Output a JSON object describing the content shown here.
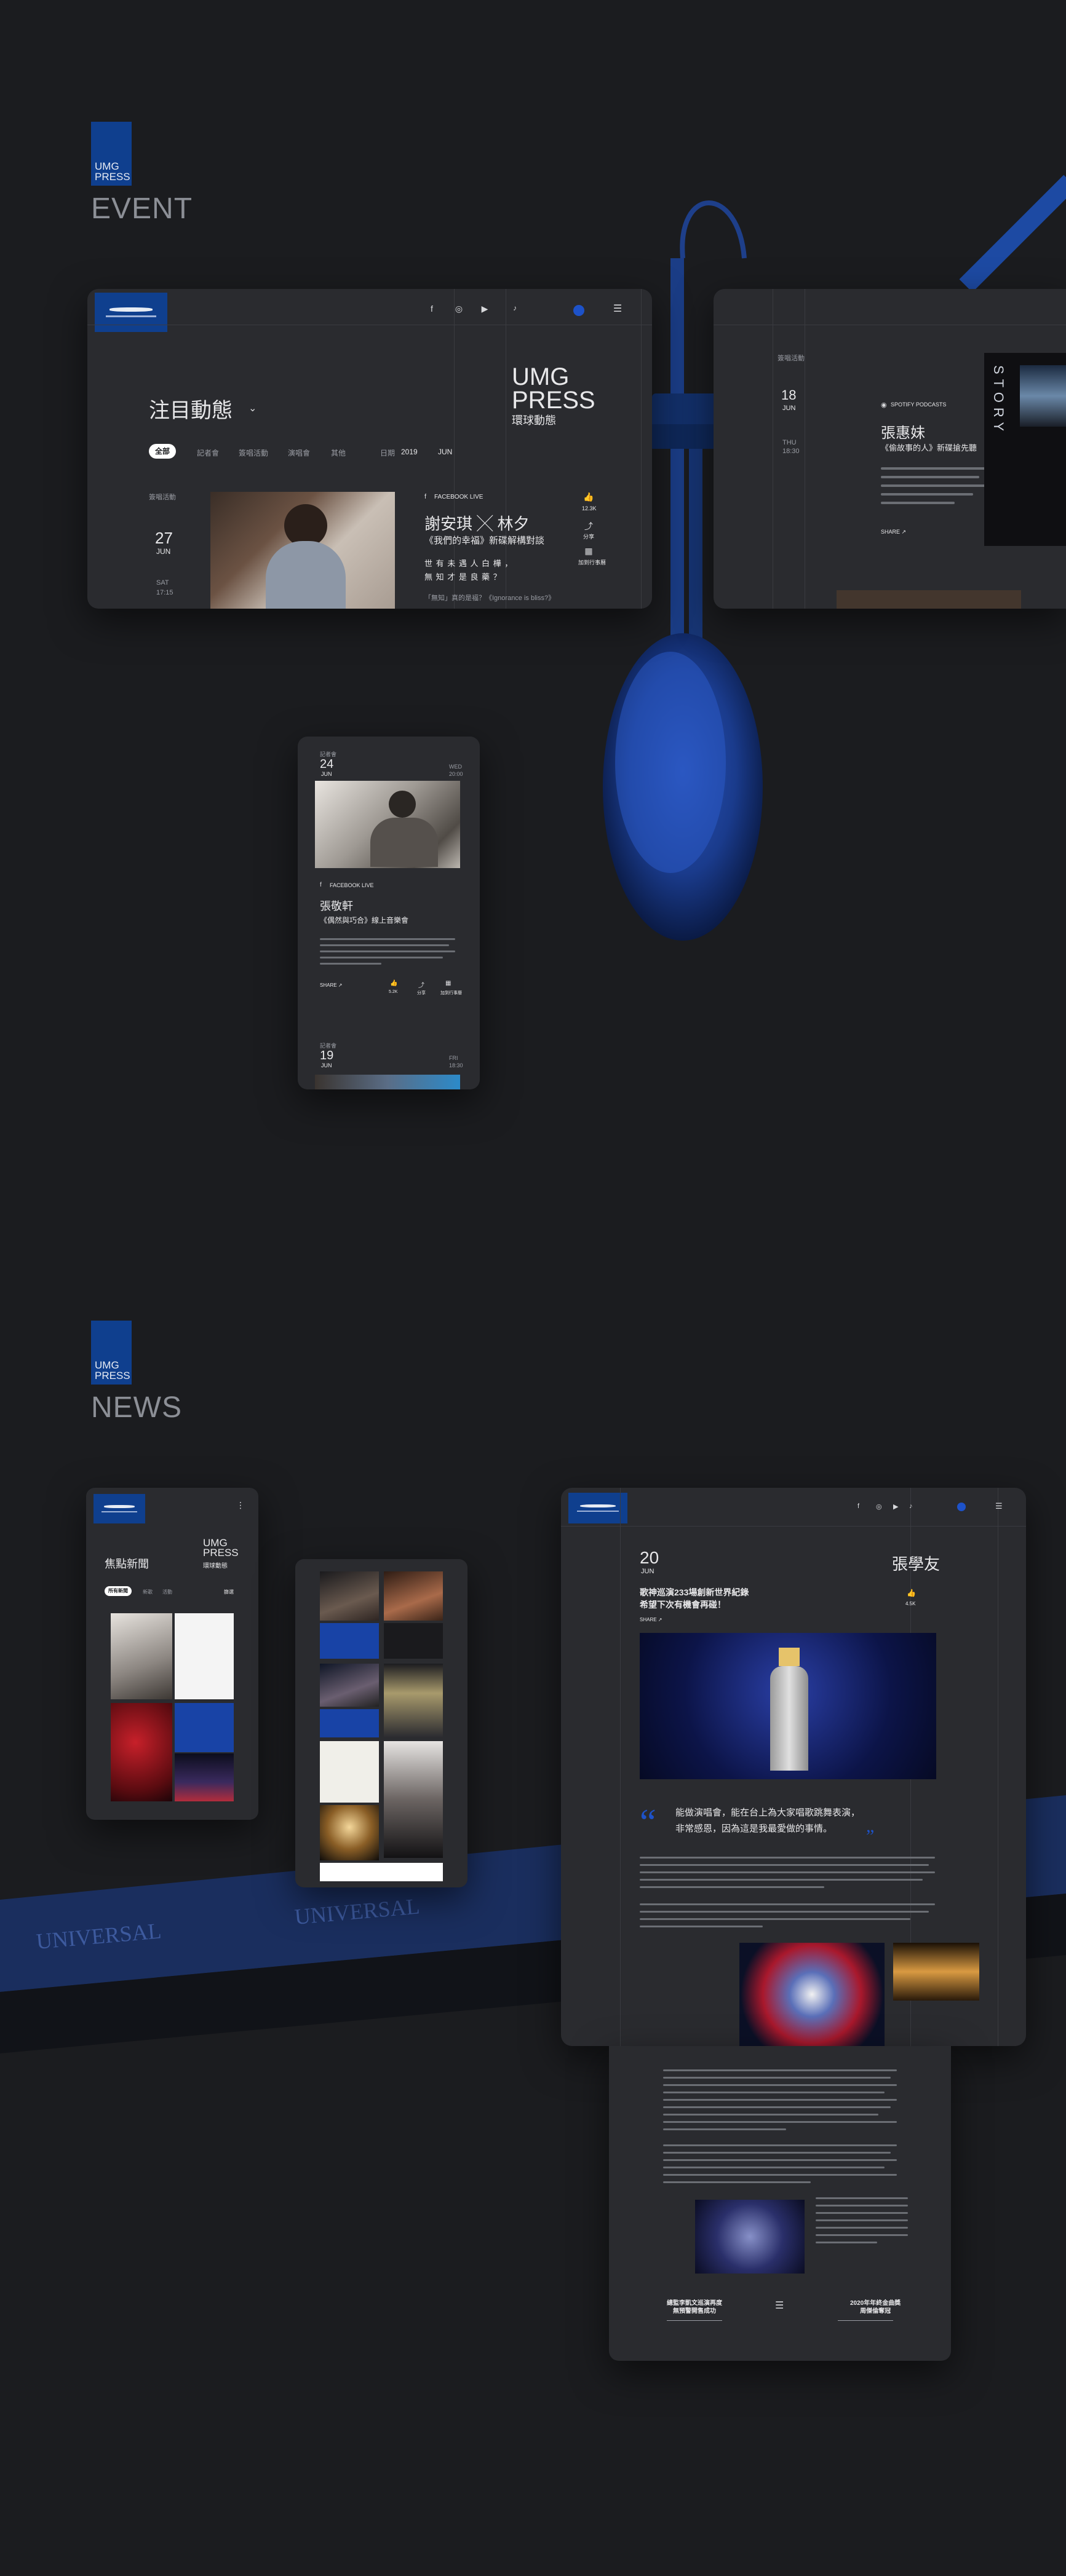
{
  "colors": {
    "background": "#1b1c1f",
    "card": "#2a2b2f",
    "brand_blue": "#0f3f8e",
    "accent_blue": "#1d52c9"
  },
  "event_section": {
    "logo_text": "UMG\nPRESS",
    "label": "EVENT",
    "desktop": {
      "nav_icons": [
        "facebook-icon",
        "instagram-icon",
        "youtube-icon",
        "linemusic-icon"
      ],
      "brand_title": "UMG\nPRESS",
      "brand_subtitle": "環球動態",
      "page_title": "注目動態",
      "filters": [
        "全部",
        "記者會",
        "簽唱活動",
        "演唱會",
        "其他"
      ],
      "date_label": "日期",
      "year": "2019",
      "month": "JUN",
      "event_category": "簽唱活動",
      "event_day": "27",
      "event_month": "JUN",
      "event_weekday": "SAT",
      "event_time": "17:15",
      "event_tag": "FACEBOOK LIVE",
      "event_title": "謝安琪 ╳ 林夕",
      "event_subtitle": "《我們的幸福》新碟解構對談",
      "event_quote": "世 有 未 遇 人 白 樺 ，\n無 知 才 是 良 藥 ？",
      "event_more": "「無知」真的是福？《Ignorance is bliss?》",
      "actions": [
        {
          "icon": "like-icon",
          "label": "12.3K"
        },
        {
          "icon": "share-icon",
          "label": "分享"
        },
        {
          "icon": "calendar-icon",
          "label": "加到行事曆"
        }
      ]
    },
    "desktop2": {
      "event_category": "簽唱活動",
      "event_day": "18",
      "event_month": "JUN",
      "event_weekday": "THU",
      "event_time": "18:30",
      "tag": "SPOTIFY PODCASTS",
      "title": "張惠妹",
      "subtitle": "《偷故事的人》新碟搶先聽",
      "side_text": "STORY",
      "share": "SHARE ↗"
    },
    "mobile": {
      "category": "記者會",
      "day": "24",
      "month": "JUN",
      "weekday": "WED",
      "time": "20:00",
      "tag": "FACEBOOK LIVE",
      "title": "張敬軒",
      "subtitle": "《偶然與巧合》線上音樂會",
      "share": "SHARE ↗",
      "actions": [
        "5.2K",
        "分享",
        "加到行事曆"
      ],
      "next_category": "記者會",
      "next_day": "19",
      "next_month": "JUN",
      "next_weekday": "FRI",
      "next_time": "18:30"
    }
  },
  "news_section": {
    "logo_text": "UMG\nPRESS",
    "label": "NEWS",
    "mobile_list": {
      "title": "焦點新聞",
      "brand_title": "UMG\nPRESS",
      "brand_subtitle": "環球動態",
      "tabs": [
        "所有新聞",
        "新歌",
        "活動"
      ],
      "filter_label": "篩選"
    },
    "article": {
      "day": "20",
      "month": "JUN",
      "artist": "張學友",
      "headline": "歌神巡演233場創新世界紀錄\n希望下次有機會再碰！",
      "like_count": "4.5K",
      "share": "SHARE ↗",
      "quote": "能做演唱會，能在台上為大家唱歌跳舞表演，\n非常感恩，因為這是我最愛做的事情。",
      "prev_title": "總監李凱文巡演再度\n無預警開售成功",
      "next_title": "2020年年終金曲獎\n周傑倫奪冠",
      "list_icon": "list-icon"
    }
  }
}
